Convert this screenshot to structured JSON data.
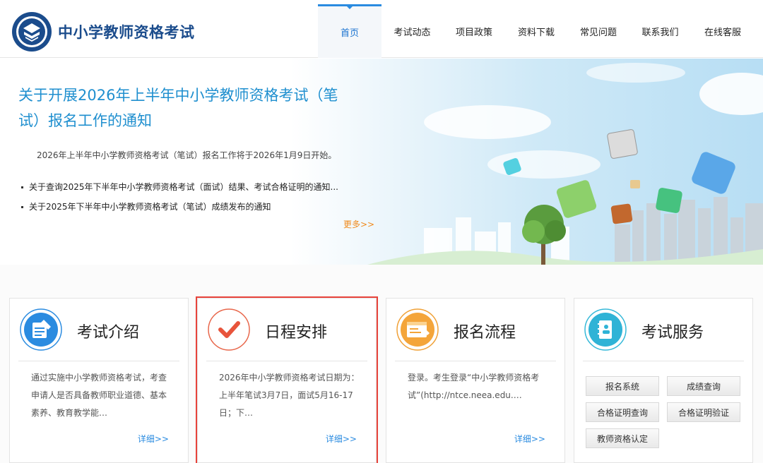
{
  "header": {
    "site_title": "中小学教师资格考试",
    "logo_icon": "exam-seal-logo",
    "nav": [
      {
        "label": "首页",
        "active": true
      },
      {
        "label": "考试动态",
        "active": false
      },
      {
        "label": "项目政策",
        "active": false
      },
      {
        "label": "资料下载",
        "active": false
      },
      {
        "label": "常见问题",
        "active": false
      },
      {
        "label": "联系我们",
        "active": false
      },
      {
        "label": "在线客服",
        "active": false
      }
    ]
  },
  "banner": {
    "headline": "关于开展2026年上半年中小学教师资格考试（笔试）报名工作的通知",
    "lead": "2026年上半年中小学教师资格考试（笔试）报名工作将于2026年1月9日开始。",
    "news": [
      "关于查询2025年下半年中小学教师资格考试（面试）结果、考试合格证明的通知...",
      "关于2025年下半年中小学教师资格考试（笔试）成绩发布的通知"
    ],
    "more": "更多>>"
  },
  "cards": [
    {
      "title": "考试介绍",
      "icon": "document-pen-icon",
      "text": "通过实施中小学教师资格考试，考查申请人是否具备教师职业道德、基本素养、教育教学能…",
      "more": "详细>>"
    },
    {
      "title": "日程安排",
      "icon": "checkmark-icon",
      "text": "2026年中小学教师资格考试日期为：上半年笔试3月7日，面试5月16-17日；下…",
      "more": "详细>>"
    },
    {
      "title": "报名流程",
      "icon": "browser-form-icon",
      "text": "登录。考生登录“中小学教师资格考试”(http://ntce.neea.edu.…",
      "more": "详细>>"
    },
    {
      "title": "考试服务",
      "icon": "notebook-icon",
      "services": [
        "报名系统",
        "成绩查询",
        "合格证明查询",
        "合格证明验证",
        "教师资格认定"
      ]
    }
  ],
  "colors": {
    "brand_blue": "#1b4c8c",
    "link_blue": "#2a8be0",
    "headline_blue": "#1f8fcf",
    "more_orange": "#f08a1c",
    "highlight_red": "#e8433b"
  }
}
